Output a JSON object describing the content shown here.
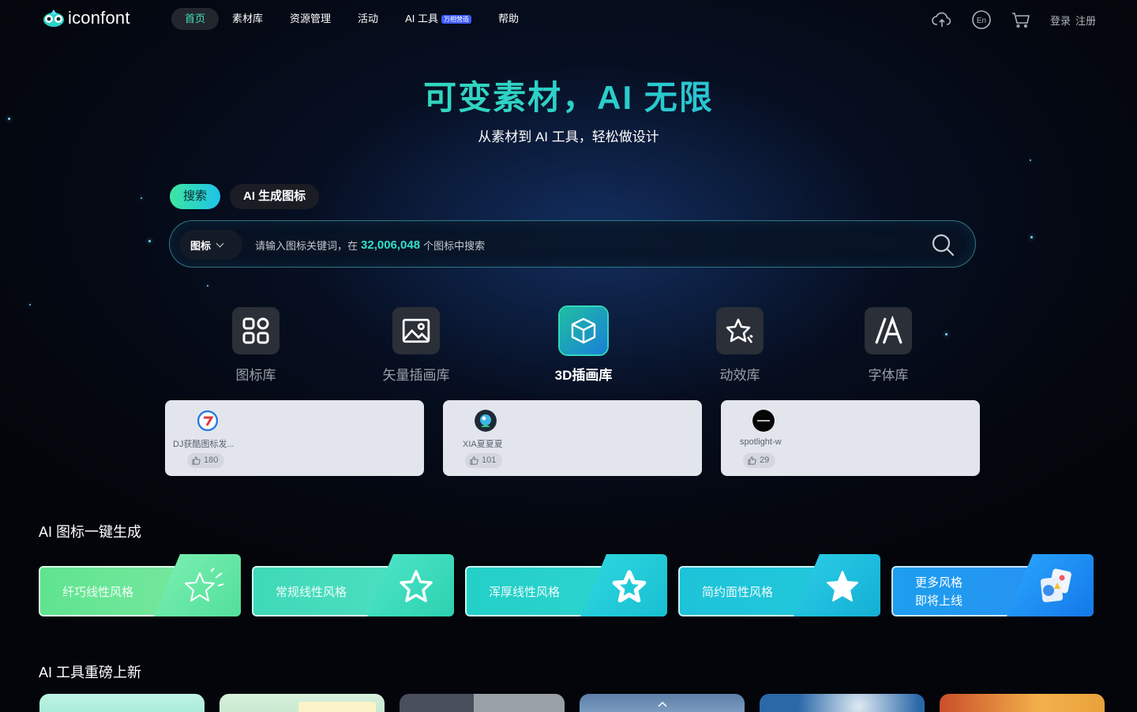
{
  "header": {
    "logo_text": "iconfont",
    "nav": [
      {
        "label": "首页",
        "active": true
      },
      {
        "label": "素材库"
      },
      {
        "label": "资源管理"
      },
      {
        "label": "活动"
      },
      {
        "label": "AI 工具",
        "tag": "万相营造"
      },
      {
        "label": "帮助"
      }
    ],
    "icons": [
      "upload-cloud-icon",
      "language-en-icon",
      "cart-icon"
    ],
    "login": "登录",
    "register": "注册"
  },
  "hero": {
    "title": "可变素材，AI 无限",
    "subtitle": "从素材到 AI 工具，轻松做设计"
  },
  "tabs": [
    {
      "label": "搜索",
      "active": true
    },
    {
      "label": "AI 生成图标"
    }
  ],
  "search": {
    "type": "图标",
    "placeholder_prefix": "请输入图标关键词，在",
    "count": "32,006,048",
    "placeholder_suffix": "个图标中搜索"
  },
  "categories": [
    {
      "label": "图标库",
      "icon": "grid-icon"
    },
    {
      "label": "矢量插画库",
      "icon": "image-icon"
    },
    {
      "label": "3D插画库",
      "icon": "cube-icon",
      "active": true
    },
    {
      "label": "动效库",
      "icon": "sparkle-star-icon"
    },
    {
      "label": "字体库",
      "icon": "font-icon"
    }
  ],
  "cards": [
    {
      "author": "DJ获酷图标发...",
      "likes": "180"
    },
    {
      "author": "XIA夏夏夏",
      "likes": "101"
    },
    {
      "author": "spotlight-w",
      "likes": "29"
    }
  ],
  "ai_section": {
    "title": "AI 图标一键生成",
    "styles": [
      {
        "label": "纤巧线性风格",
        "color": "#4fd98c"
      },
      {
        "label": "常规线性风格",
        "color": "#30d3b3"
      },
      {
        "label": "浑厚线性风格",
        "color": "#1ec8c6"
      },
      {
        "label": "简约面性风格",
        "color": "#1cb9da"
      },
      {
        "label_line1": "更多风格",
        "label_line2": "即将上线",
        "color": "#1a8ff0"
      }
    ]
  },
  "tools_section": {
    "title": "AI 工具重磅上新"
  },
  "colors": {
    "accent_green": "#3ee0b3",
    "accent_blue": "#1da7f2",
    "background": "#03050a"
  }
}
